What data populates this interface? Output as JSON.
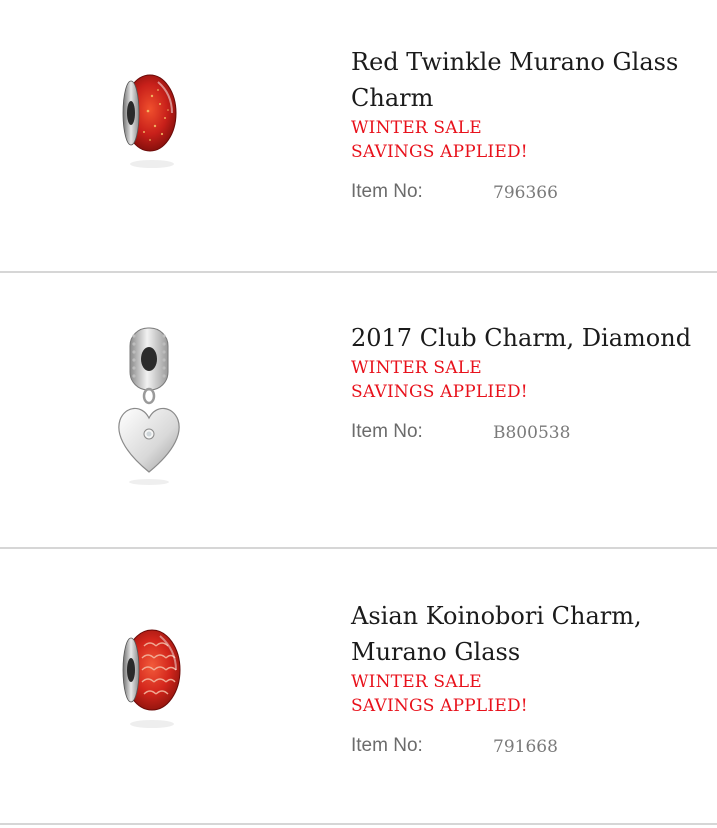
{
  "products": [
    {
      "title_line1": "Red Twinkle Murano Glass",
      "title_line2": "Charm",
      "promo_line1": "WINTER SALE",
      "promo_line2": "SAVINGS APPLIED!",
      "item_label": "Item No:",
      "item_number": "796366",
      "image_icon": "red-glass-bead-icon"
    },
    {
      "title_line1": "2017 Club Charm, Diamond",
      "title_line2": "",
      "promo_line1": "WINTER SALE",
      "promo_line2": "SAVINGS APPLIED!",
      "item_label": "Item No:",
      "item_number": "B800538",
      "image_icon": "silver-heart-dangle-icon"
    },
    {
      "title_line1": "Asian Koinobori Charm,",
      "title_line2": "Murano Glass",
      "promo_line1": "WINTER SALE",
      "promo_line2": "SAVINGS APPLIED!",
      "item_label": "Item No:",
      "item_number": "791668",
      "image_icon": "red-scale-glass-bead-icon"
    }
  ],
  "colors": {
    "promo": "#e8111b",
    "title": "#1b1b1b",
    "label": "#6b6b6b",
    "divider": "#d6d6d6"
  }
}
